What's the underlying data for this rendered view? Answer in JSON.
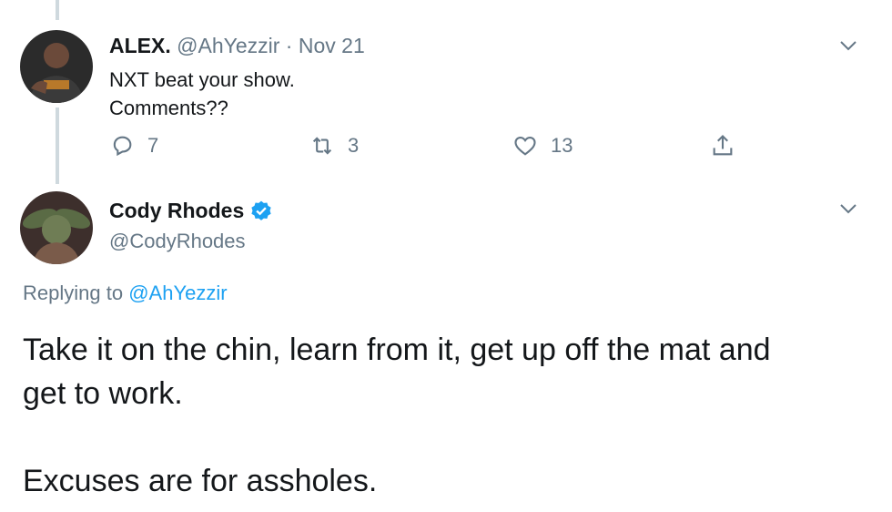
{
  "tweet1": {
    "name": "ALEX.",
    "handle": "@AhYezzir",
    "separator": "·",
    "date": "Nov 21",
    "text_line1": "NXT beat your show.",
    "text_line2": "Comments??",
    "actions": {
      "replies": "7",
      "retweets": "3",
      "likes": "13"
    }
  },
  "tweet2": {
    "name": "Cody Rhodes",
    "verified": true,
    "handle": "@CodyRhodes",
    "replying_prefix": "Replying to",
    "replying_handle": "@AhYezzir",
    "body_line1": "Take it on the chin, learn from it, get up off the mat and",
    "body_line2": "get to work.",
    "body_line3": "Excuses are for assholes."
  },
  "icons": {
    "reply": "reply-icon",
    "retweet": "retweet-icon",
    "like": "heart-icon",
    "share": "share-icon",
    "caret": "chevron-down-icon",
    "verified": "verified-badge-icon"
  },
  "colors": {
    "text": "#14171a",
    "secondary": "#657786",
    "link": "#1da1f2",
    "thread_line": "#cfd9de"
  }
}
